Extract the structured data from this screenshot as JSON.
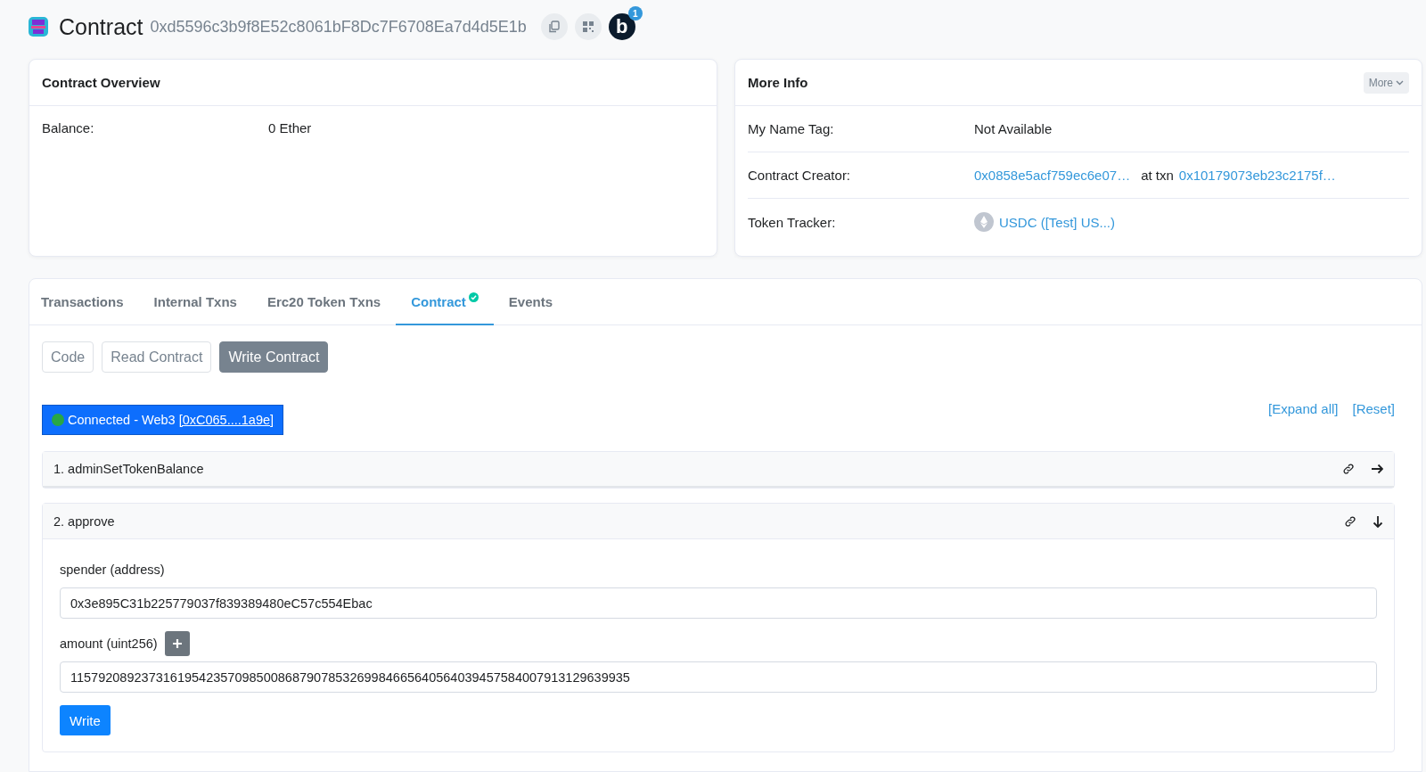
{
  "header": {
    "title": "Contract",
    "address": "0xd5596c3b9f8E52c8061bF8Dc7F6708Ea7d4d5E1b",
    "notification_count": "1",
    "avatar_letter": "b"
  },
  "overview": {
    "title": "Contract Overview",
    "rows": [
      {
        "label": "Balance:",
        "value": "0 Ether"
      }
    ]
  },
  "more_info": {
    "title": "More Info",
    "more_button": "More",
    "name_tag": {
      "label": "My Name Tag:",
      "value": "Not Available"
    },
    "creator": {
      "label": "Contract Creator:",
      "address": "0x0858e5acf759ec6e07…",
      "at_txn": "at txn",
      "txn": "0x10179073eb23c2175f…"
    },
    "token_tracker": {
      "label": "Token Tracker:",
      "value": "USDC ([Test] US...)"
    }
  },
  "tabs": [
    {
      "label": "Transactions",
      "selected": false,
      "verified": false
    },
    {
      "label": "Internal Txns",
      "selected": false,
      "verified": false
    },
    {
      "label": "Erc20 Token Txns",
      "selected": false,
      "verified": false
    },
    {
      "label": "Contract",
      "selected": true,
      "verified": true
    },
    {
      "label": "Events",
      "selected": false,
      "verified": false
    }
  ],
  "sub_tabs": [
    {
      "label": "Code",
      "selected": false
    },
    {
      "label": "Read Contract",
      "selected": false
    },
    {
      "label": "Write Contract",
      "selected": true
    }
  ],
  "connection": {
    "connected": true,
    "text": "Connected - Web3",
    "account": "[0xC065....1a9e]"
  },
  "expand_all": "[Expand all]",
  "reset": "[Reset]",
  "functions": [
    {
      "title": "1. adminSetTokenBalance",
      "expanded": false
    },
    {
      "title": "2. approve",
      "expanded": true,
      "params": [
        {
          "label": "spender (address)",
          "value": "0x3e895C31b225779037f839389480eC57c554Ebac",
          "add_button": false
        },
        {
          "label": "amount (uint256)",
          "value": "115792089237316195423570985008687907853269984665640564039457584007913129639935",
          "add_button": true
        }
      ],
      "submit": "Write"
    }
  ]
}
